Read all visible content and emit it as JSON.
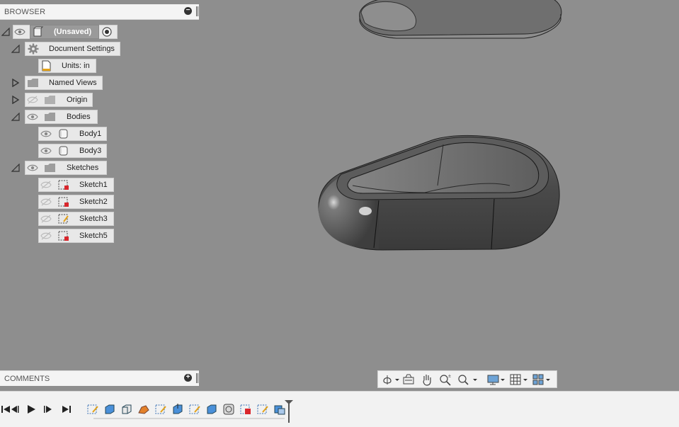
{
  "browser": {
    "title": "BROWSER",
    "collapse_symbol": "−",
    "root": {
      "label": "(Unsaved)"
    },
    "items": [
      {
        "label": "Document Settings",
        "icon": "gear-icon"
      },
      {
        "label": "Units: in",
        "icon": "units-icon"
      },
      {
        "label": "Named Views",
        "icon": "folder-icon"
      },
      {
        "label": "Origin",
        "icon": "folder-icon"
      },
      {
        "label": "Bodies",
        "icon": "folder-icon"
      },
      {
        "label": "Body1",
        "icon": "body-icon"
      },
      {
        "label": "Body3",
        "icon": "body-icon"
      },
      {
        "label": "Sketches",
        "icon": "folder-icon"
      },
      {
        "label": "Sketch1",
        "icon": "sketch-icon"
      },
      {
        "label": "Sketch2",
        "icon": "sketch-icon"
      },
      {
        "label": "Sketch3",
        "icon": "sketch-icon"
      },
      {
        "label": "Sketch5",
        "icon": "sketch-icon"
      }
    ]
  },
  "comments": {
    "title": "COMMENTS",
    "add_symbol": "+"
  },
  "navbar": {
    "tools": [
      "orbit-icon",
      "look-at-icon",
      "pan-icon",
      "zoom-icon",
      "fit-icon",
      "display-settings-icon",
      "grid-icon",
      "viewports-icon"
    ]
  },
  "timeline": {
    "controls": [
      "go-to-start-icon",
      "step-back-icon",
      "play-icon",
      "step-forward-icon",
      "go-to-end-icon"
    ],
    "features": [
      "sketch-icon",
      "extrude-icon",
      "box-icon",
      "fillet-icon",
      "sketch-icon",
      "extrude-icon",
      "sketch-icon",
      "extrude-icon",
      "shell-icon",
      "sketch-icon",
      "split-icon",
      "sketch-icon",
      "combine-icon"
    ]
  },
  "colors": {
    "viewport_bg": "#8e8e8e",
    "panel_bg": "#f4f4f4",
    "sketch_red": "#d9262c"
  }
}
